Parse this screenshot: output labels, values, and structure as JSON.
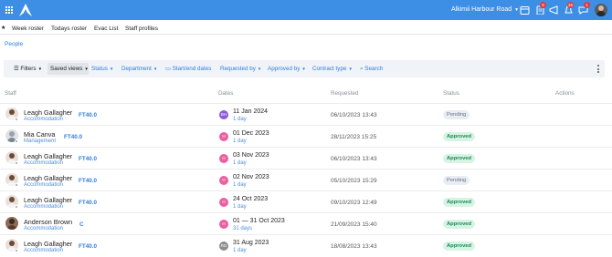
{
  "topbar": {
    "location": "Alkimii Harbour Road",
    "icon_names": [
      "grid-icon",
      "logo",
      "calendar-icon",
      "clipboard-icon",
      "megaphone-icon",
      "bell-icon",
      "chat-icon",
      "user-avatar"
    ],
    "badges": {
      "clipboard": "9",
      "bell": "35",
      "chat": "1"
    },
    "color": "#3d8fe6"
  },
  "subnav": {
    "items": [
      "Week roster",
      "Todays roster",
      "Evac List",
      "Staff profiles"
    ]
  },
  "page": {
    "title": "People"
  },
  "filters": {
    "filters_label": "Filters",
    "saved_views_label": "Saved views",
    "status_label": "Status",
    "department_label": "Department",
    "dates_label": "Start/end dates",
    "requested_by_label": "Requested by",
    "approved_by_label": "Approved by",
    "contract_type_label": "Contract type",
    "search_label": "Search"
  },
  "table": {
    "headers": {
      "staff": "Staff",
      "dates": "Dates",
      "requested": "Requested",
      "status": "Status",
      "actions": "Actions"
    },
    "rows": [
      {
        "name": "Leagh Gallagher",
        "dept": "Accommodation",
        "contract": "FT40.0",
        "initials": "BH",
        "initials_color": "#8e5bd6",
        "date": "11 Jan 2024",
        "days": "1 day",
        "requested": "06/10/2023 13:43",
        "status": "Pending"
      },
      {
        "name": "Mia Canva",
        "dept": "Management",
        "contract": "FT40.0",
        "initials": "H",
        "initials_color": "#ec5fa0",
        "date": "01 Dec 2023",
        "days": "1 day",
        "requested": "28/11/2023 15:25",
        "status": "Approved"
      },
      {
        "name": "Leagh Gallagher",
        "dept": "Accommodation",
        "contract": "FT40.0",
        "initials": "H",
        "initials_color": "#ec5fa0",
        "date": "03 Nov 2023",
        "days": "1 day",
        "requested": "06/10/2023 13:43",
        "status": "Approved"
      },
      {
        "name": "Leagh Gallagher",
        "dept": "Accommodation",
        "contract": "FT40.0",
        "initials": "H",
        "initials_color": "#ec5fa0",
        "date": "02 Nov 2023",
        "days": "1 day",
        "requested": "05/10/2023 15:29",
        "status": "Pending"
      },
      {
        "name": "Leagh Gallagher",
        "dept": "Accommodation",
        "contract": "FT40.0",
        "initials": "H",
        "initials_color": "#ec5fa0",
        "date": "24 Oct 2023",
        "days": "1 day",
        "requested": "09/10/2023 12:49",
        "status": "Approved"
      },
      {
        "name": "Anderson Brown",
        "dept": "Accommodation",
        "contract": "C",
        "initials": "H",
        "initials_color": "#ec5fa0",
        "date": "01 — 31 Oct 2023",
        "days": "31 days",
        "requested": "21/09/2023 15:40",
        "status": "Approved"
      },
      {
        "name": "Leagh Gallagher",
        "dept": "Accommodation",
        "contract": "FT40.0",
        "initials": "RD",
        "initials_color": "#8d8d8d",
        "date": "31 Aug 2023",
        "days": "1 day",
        "requested": "18/08/2023 13:43",
        "status": "Approved"
      }
    ]
  }
}
